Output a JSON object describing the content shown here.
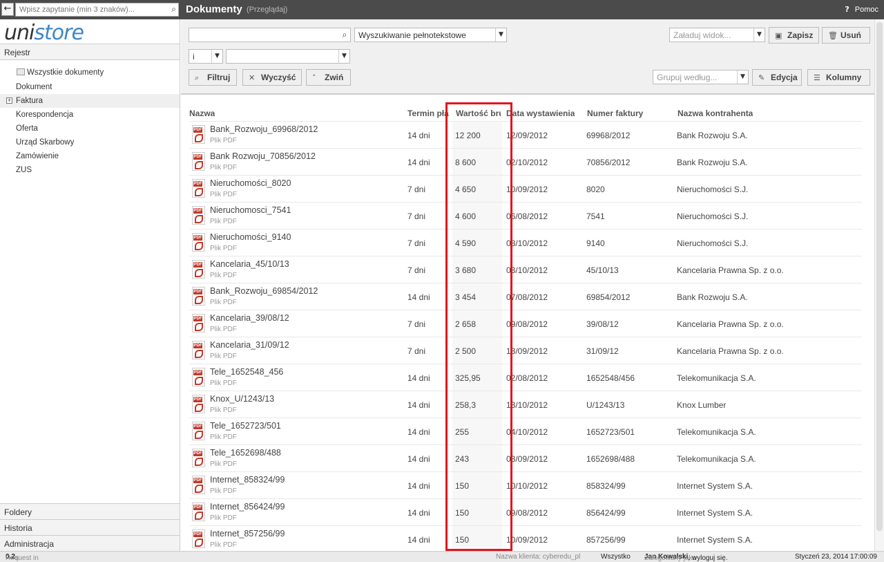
{
  "topbar": {
    "back_label": "←",
    "search_placeholder": "Wpisz zapytanie (min 3 znaków)...",
    "title": "Dokumenty",
    "subtitle": "(Przeglądaj)",
    "help_label": "Pomoc"
  },
  "sidebar": {
    "logo_uni": "uni",
    "logo_store": "store",
    "rejestr": "Rejestr",
    "root": "Wszystkie dokumenty",
    "items": [
      "Dokument",
      "Faktura",
      "Korespondencja",
      "Oferta",
      "Urząd Skarbowy",
      "Zamówienie",
      "ZUS"
    ],
    "bottom": [
      "Foldery",
      "Historia",
      "Administracja"
    ]
  },
  "toolbar": {
    "search_value": "",
    "search_type": "Wyszukiwanie pełnotekstowe",
    "op_value": "i",
    "field_value": "",
    "load_view_placeholder": "Załaduj widok...",
    "save_label": "Zapisz",
    "delete_label": "Usuń",
    "filter_label": "Filtruj",
    "clear_label": "Wyczyść",
    "collapse_label": "Zwiń",
    "group_placeholder": "Grupuj według...",
    "edit_label": "Edycja",
    "columns_label": "Kolumny"
  },
  "table": {
    "headers": [
      "Nazwa",
      "Termin pła",
      "Wartość bru",
      "Data wystawienia",
      "Numer faktury",
      "Nazwa kontrahenta"
    ],
    "rows": [
      {
        "name": "Bank_Rozwoju_69968/2012",
        "type": "Plik PDF",
        "term": "14 dni",
        "value": "12 200",
        "date": "12/09/2012",
        "num": "69968/2012",
        "kontr": "Bank Rozwoju S.A."
      },
      {
        "name": "Bank Rozwoju_70856/2012",
        "type": "Plik PDF",
        "term": "14 dni",
        "value": "8 600",
        "date": "02/10/2012",
        "num": "70856/2012",
        "kontr": "Bank Rozwoju S.A."
      },
      {
        "name": "Nieruchomości_8020",
        "type": "Plik PDF",
        "term": "7 dni",
        "value": "4 650",
        "date": "10/09/2012",
        "num": "8020",
        "kontr": "Nieruchomości S.J."
      },
      {
        "name": "Nieruchomosci_7541",
        "type": "Plik PDF",
        "term": "7 dni",
        "value": "4 600",
        "date": "06/08/2012",
        "num": "7541",
        "kontr": "Nieruchomości S.J."
      },
      {
        "name": "Nieruchomości_9140",
        "type": "Plik PDF",
        "term": "7 dni",
        "value": "4 590",
        "date": "08/10/2012",
        "num": "9140",
        "kontr": "Nieruchomości S.J."
      },
      {
        "name": "Kancelaria_45/10/13",
        "type": "Plik PDF",
        "term": "7 dni",
        "value": "3 680",
        "date": "03/10/2012",
        "num": "45/10/13",
        "kontr": "Kancelaria Prawna Sp. z o.o."
      },
      {
        "name": "Bank_Rozwoju_69854/2012",
        "type": "Plik PDF",
        "term": "14 dni",
        "value": "3 454",
        "date": "07/08/2012",
        "num": "69854/2012",
        "kontr": "Bank Rozwoju S.A."
      },
      {
        "name": "Kancelaria_39/08/12",
        "type": "Plik PDF",
        "term": "7 dni",
        "value": "2 658",
        "date": "09/08/2012",
        "num": "39/08/12",
        "kontr": "Kancelaria Prawna Sp. z o.o."
      },
      {
        "name": "Kancelaria_31/09/12",
        "type": "Plik PDF",
        "term": "7 dni",
        "value": "2 500",
        "date": "13/09/2012",
        "num": "31/09/12",
        "kontr": "Kancelaria Prawna Sp. z o.o."
      },
      {
        "name": "Tele_1652548_456",
        "type": "Plik PDF",
        "term": "14 dni",
        "value": "325,95",
        "date": "02/08/2012",
        "num": "1652548/456",
        "kontr": "Telekomunikacja S.A."
      },
      {
        "name": "Knox_U/1243/13",
        "type": "Plik PDF",
        "term": "14 dni",
        "value": "258,3",
        "date": "13/10/2012",
        "num": "U/1243/13",
        "kontr": "Knox Lumber"
      },
      {
        "name": "Tele_1652723/501",
        "type": "Plik PDF",
        "term": "14 dni",
        "value": "255",
        "date": "04/10/2012",
        "num": "1652723/501",
        "kontr": "Telekomunikacja S.A."
      },
      {
        "name": "Tele_1652698/488",
        "type": "Plik PDF",
        "term": "14 dni",
        "value": "243",
        "date": "03/09/2012",
        "num": "1652698/488",
        "kontr": "Telekomunikacja S.A."
      },
      {
        "name": "Internet_858324/99",
        "type": "Plik PDF",
        "term": "14 dni",
        "value": "150",
        "date": "10/10/2012",
        "num": "858324/99",
        "kontr": "Internet System S.A."
      },
      {
        "name": "Internet_856424/99",
        "type": "Plik PDF",
        "term": "14 dni",
        "value": "150",
        "date": "09/08/2012",
        "num": "856424/99",
        "kontr": "Internet System S.A."
      },
      {
        "name": "Internet_857256/99",
        "type": "Plik PDF",
        "term": "14 dni",
        "value": "150",
        "date": "10/09/2012",
        "num": "857256/99",
        "kontr": "Internet System S.A."
      }
    ]
  },
  "status": {
    "request_prefix": "Request in ",
    "request_time": "0.2",
    "request_suffix": "s",
    "client": "Nazwa klienta: cyberedu_pl",
    "scope": "Wszystko",
    "logged_prefix": "Zalogowany jako",
    "user": "Jan Kowalski",
    "logout": ", wyloguj się.",
    "datetime": "Styczeń 23, 2014 17:00:09"
  }
}
